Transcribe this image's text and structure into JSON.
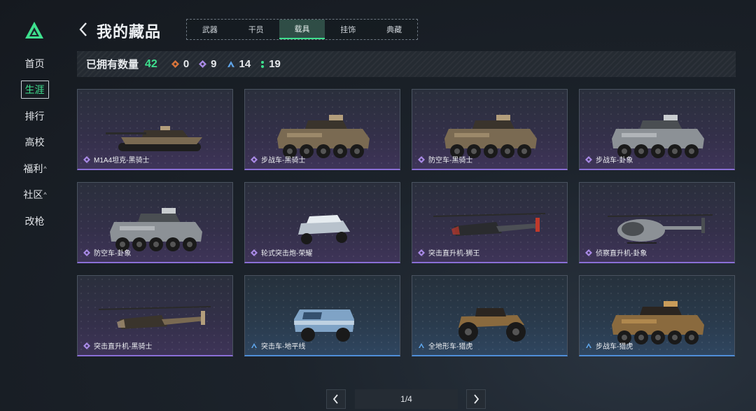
{
  "sidebar": {
    "logo_icon": "triangle-logo-icon",
    "items": [
      {
        "label": "首页",
        "caret": ""
      },
      {
        "label": "生涯",
        "caret": ""
      },
      {
        "label": "排行",
        "caret": ""
      },
      {
        "label": "高校",
        "caret": ""
      },
      {
        "label": "福利",
        "caret": "^"
      },
      {
        "label": "社区",
        "caret": "^"
      },
      {
        "label": "改枪",
        "caret": ""
      }
    ],
    "active_index": 1
  },
  "header": {
    "title": "我的藏品",
    "tabs": [
      "武器",
      "干员",
      "载具",
      "挂饰",
      "典藏"
    ],
    "active_tab": 2
  },
  "stats": {
    "owned_label": "已拥有数量",
    "owned_count": "42",
    "rarities": [
      {
        "icon": "orange-diamond-icon",
        "color": "#d9743a",
        "count": "0"
      },
      {
        "icon": "purple-diamond-icon",
        "color": "#a98ae6",
        "count": "9"
      },
      {
        "icon": "blue-triangle-icon",
        "color": "#5fa4e8",
        "count": "14"
      },
      {
        "icon": "green-dots-icon",
        "color": "#3ee08e",
        "count": "19"
      }
    ]
  },
  "cards": [
    {
      "name": "M1A4坦克-黑骑士",
      "rarity": "purple",
      "kind": "tank",
      "camo": "black-knight"
    },
    {
      "name": "步战车-黑骑士",
      "rarity": "purple",
      "kind": "ifv",
      "camo": "black-knight"
    },
    {
      "name": "防空车-黑骑士",
      "rarity": "purple",
      "kind": "ifv",
      "camo": "black-knight"
    },
    {
      "name": "步战车-卦象",
      "rarity": "purple",
      "kind": "ifv",
      "camo": "grey"
    },
    {
      "name": "防空车-卦象",
      "rarity": "purple",
      "kind": "ifv",
      "camo": "grey"
    },
    {
      "name": "轮式突击炮-荣耀",
      "rarity": "purple",
      "kind": "buggy",
      "camo": "white"
    },
    {
      "name": "突击直升机-狮王",
      "rarity": "purple",
      "kind": "heli",
      "camo": "red"
    },
    {
      "name": "侦察直升机-卦象",
      "rarity": "purple",
      "kind": "scout",
      "camo": "grey"
    },
    {
      "name": "突击直升机-黑骑士",
      "rarity": "purple",
      "kind": "heli",
      "camo": "black-knight"
    },
    {
      "name": "突击车-地平线",
      "rarity": "blue",
      "kind": "truck",
      "camo": "blue"
    },
    {
      "name": "全地形车-猎虎",
      "rarity": "blue",
      "kind": "atv",
      "camo": "tiger"
    },
    {
      "name": "步战车-猎虎",
      "rarity": "blue",
      "kind": "ifv",
      "camo": "tiger"
    }
  ],
  "pager": {
    "text": "1/4",
    "prev_icon": "chevron-left-icon",
    "next_icon": "chevron-right-icon"
  },
  "colors": {
    "accent": "#3ee08e",
    "purple": "#8a6fd6",
    "blue": "#4f8ed8"
  }
}
